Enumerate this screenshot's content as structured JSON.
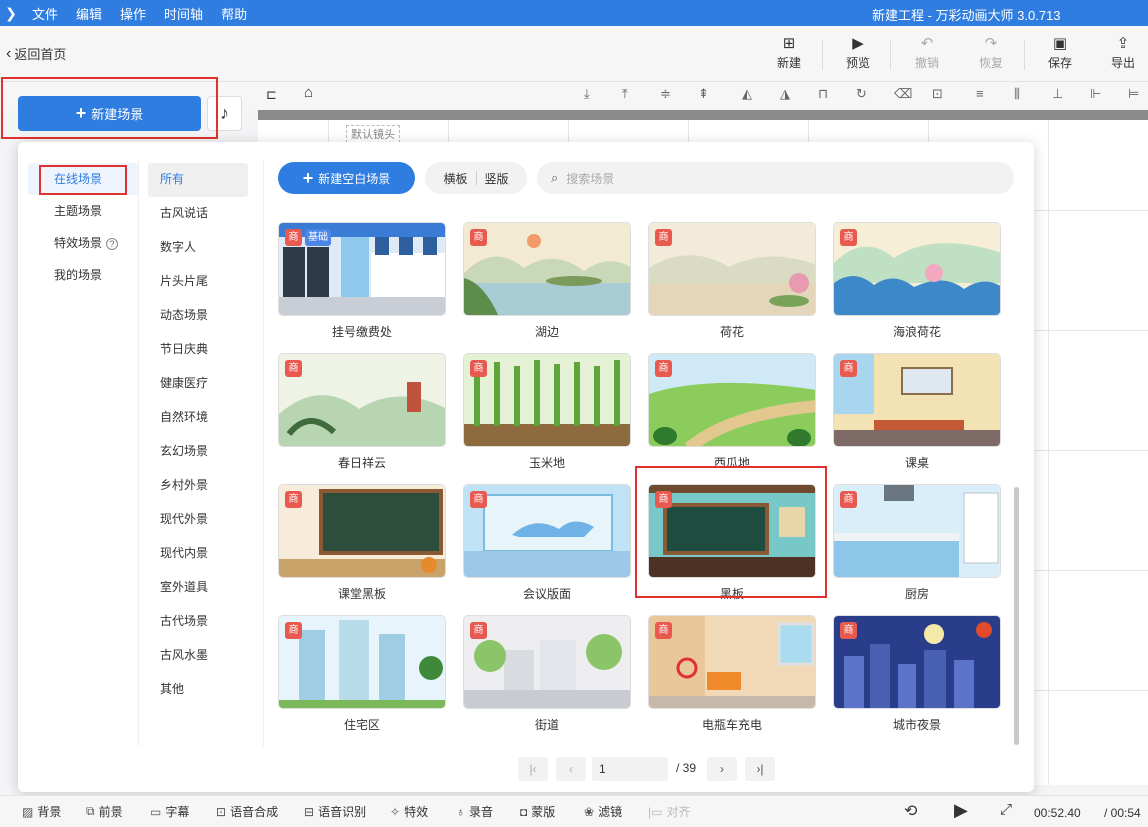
{
  "app": {
    "title": "新建工程 - 万彩动画大师 3.0.713",
    "menu": [
      "文件",
      "编辑",
      "操作",
      "时间轴",
      "帮助"
    ]
  },
  "topbar": {
    "back_label": "返回首页",
    "buttons": [
      {
        "label": "新建",
        "icon": "plus-square-icon",
        "enabled": true
      },
      {
        "label": "预览",
        "icon": "play-icon",
        "enabled": true
      },
      {
        "label": "撤销",
        "icon": "undo-icon",
        "enabled": false
      },
      {
        "label": "恢复",
        "icon": "redo-icon",
        "enabled": false
      },
      {
        "label": "保存",
        "icon": "save-icon",
        "enabled": true
      },
      {
        "label": "导出",
        "icon": "export-icon",
        "enabled": true
      }
    ]
  },
  "new_scene_label": "新建场景",
  "canvas": {
    "camera_label": "默认镜头"
  },
  "scene_panel": {
    "primary_categories": [
      {
        "label": "在线场景",
        "active": true
      },
      {
        "label": "主题场景",
        "active": false
      },
      {
        "label": "特效场景",
        "active": false,
        "help": "?"
      },
      {
        "label": "我的场景",
        "active": false
      }
    ],
    "secondary_categories": [
      {
        "label": "所有",
        "active": true
      },
      {
        "label": "古风说话"
      },
      {
        "label": "数字人"
      },
      {
        "label": "片头片尾"
      },
      {
        "label": "动态场景"
      },
      {
        "label": "节日庆典"
      },
      {
        "label": "健康医疗"
      },
      {
        "label": "自然环境"
      },
      {
        "label": "玄幻场景"
      },
      {
        "label": "乡村外景"
      },
      {
        "label": "现代外景"
      },
      {
        "label": "现代内景"
      },
      {
        "label": "室外道具"
      },
      {
        "label": "古代场景"
      },
      {
        "label": "古风水墨"
      },
      {
        "label": "其他"
      }
    ],
    "blank_scene_label": "新建空白场景",
    "orientation": {
      "landscape": "横板",
      "portrait": "竖版"
    },
    "search_placeholder": "搜索场景",
    "badge_commercial": "商",
    "badge_basic": "基础",
    "scenes": [
      {
        "name": "挂号缴费处",
        "badges": [
          "商",
          "基础"
        ]
      },
      {
        "name": "湖边",
        "badges": [
          "商"
        ]
      },
      {
        "name": "荷花",
        "badges": [
          "商"
        ]
      },
      {
        "name": "海浪荷花",
        "badges": [
          "商"
        ]
      },
      {
        "name": "春日祥云",
        "badges": [
          "商"
        ]
      },
      {
        "name": "玉米地",
        "badges": [
          "商"
        ]
      },
      {
        "name": "西瓜地",
        "badges": [
          "商"
        ]
      },
      {
        "name": "课桌",
        "badges": [
          "商"
        ]
      },
      {
        "name": "课堂黑板",
        "badges": [
          "商"
        ]
      },
      {
        "name": "会议版面",
        "badges": [
          "商"
        ]
      },
      {
        "name": "黑板",
        "badges": [
          "商"
        ],
        "highlighted": true
      },
      {
        "name": "厨房",
        "badges": [
          "商"
        ]
      },
      {
        "name": "住宅区",
        "badges": [
          "商"
        ]
      },
      {
        "name": "街道",
        "badges": [
          "商"
        ]
      },
      {
        "name": "电瓶车充电",
        "badges": [
          "商"
        ]
      },
      {
        "name": "城市夜景",
        "badges": [
          "商"
        ]
      }
    ],
    "pagination": {
      "current": "1",
      "total": "/ 39"
    }
  },
  "bottombar": {
    "items": [
      {
        "label": "背景",
        "icon": "background-icon"
      },
      {
        "label": "前景",
        "icon": "foreground-icon"
      },
      {
        "label": "字幕",
        "icon": "subtitle-icon"
      },
      {
        "label": "语音合成",
        "icon": "tts-icon"
      },
      {
        "label": "语音识别",
        "icon": "asr-icon"
      },
      {
        "label": "特效",
        "icon": "effects-icon"
      },
      {
        "label": "录音",
        "icon": "microphone-icon"
      },
      {
        "label": "蒙版",
        "icon": "mask-icon"
      },
      {
        "label": "滤镜",
        "icon": "filter-icon"
      },
      {
        "label": "对齐",
        "icon": "align-icon",
        "enabled": false
      }
    ],
    "time_current": "00:52.40",
    "time_total": "/ 00:54"
  },
  "colors": {
    "accent": "#2f7de1",
    "highlight": "#e0312e",
    "badge": "#e85a4f"
  }
}
